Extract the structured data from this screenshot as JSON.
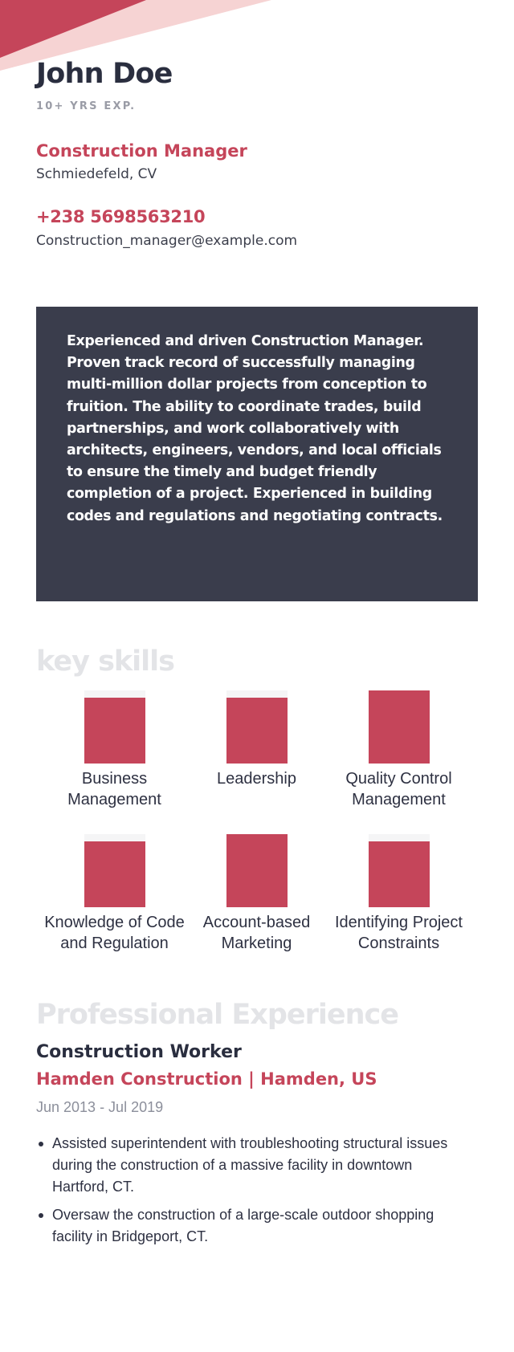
{
  "colors": {
    "accent": "#c5455a",
    "accent_light": "#f6d3d3",
    "dark": "#2a2e3f",
    "summary_bg": "#3a3d4c",
    "section_title": "#e3e4e7",
    "muted": "#9a9ca6"
  },
  "header": {
    "name": "John Doe",
    "experience": "10+ YRS EXP.",
    "title": "Construction Manager",
    "location": "Schmiedefeld, CV",
    "phone": "+238 5698563210",
    "email": "Construction_manager@example.com"
  },
  "summary": {
    "text": "Experienced and driven Construction Manager. Proven track record of successfully managing multi-million dollar projects from conception to fruition. The ability to coordinate trades, build partnerships, and work collaboratively with architects, engineers, vendors, and local officials to ensure the timely and budget friendly completion of a project. Experienced in building codes and regulations and negotiating contracts."
  },
  "skills": {
    "title": "key skills",
    "items": [
      {
        "label": "Business Management",
        "level": 0.9
      },
      {
        "label": "Leadership",
        "level": 0.9
      },
      {
        "label": "Quality Control Management",
        "level": 1.0
      },
      {
        "label": "Knowledge of Code and Regulation",
        "level": 0.9
      },
      {
        "label": "Account-based Marketing",
        "level": 1.0
      },
      {
        "label": "Identifying Project Constraints",
        "level": 0.9
      }
    ]
  },
  "experience": {
    "title": "Professional Experience",
    "jobs": [
      {
        "role": "Construction Worker",
        "company": "Hamden Construction | Hamden, US",
        "dates": "Jun 2013 - Jul 2019",
        "bullets": [
          "Assisted superintendent with troubleshooting structural issues during the construction of a massive facility in downtown Hartford, CT.",
          "Oversaw the construction of a large-scale outdoor shopping facility in Bridgeport, CT."
        ]
      }
    ]
  }
}
